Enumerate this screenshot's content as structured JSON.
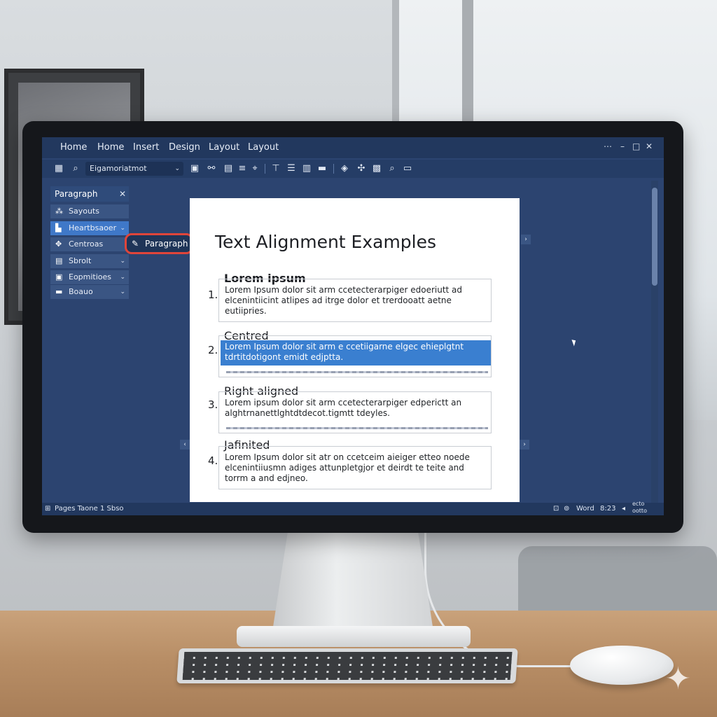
{
  "menubar": {
    "items": [
      "Home",
      "Home",
      "Insert",
      "Design",
      "Layout",
      "Layout"
    ]
  },
  "window_controls": {
    "menu": "⋯",
    "minimize": "–",
    "maximize": "□",
    "close": "✕"
  },
  "toolbar": {
    "style_select": "Eigamoriatmot",
    "icons": [
      "table-icon",
      "search-icon",
      "style-icon",
      "text-box-icon",
      "link-icon",
      "image-icon",
      "list-icon",
      "review-icon",
      "align-icon",
      "align-left-icon",
      "format-icon",
      "media-icon",
      "shapes-icon",
      "chart-icon",
      "picture-icon",
      "find-icon",
      "folder-icon"
    ]
  },
  "panel": {
    "title": "Paragraph",
    "close": "✕",
    "items": [
      {
        "label": "Sayouts",
        "icon": "layout-icon",
        "chevron": false,
        "active": false
      },
      {
        "label": "Heartbsaoer",
        "icon": "header-icon",
        "chevron": true,
        "active": true
      },
      {
        "label": "Centroas",
        "icon": "center-icon",
        "chevron": false,
        "active": false
      },
      {
        "label": "Sbrolt",
        "icon": "scroll-icon",
        "chevron": true,
        "active": false
      },
      {
        "label": "Eopmitioes",
        "icon": "format-icon",
        "chevron": true,
        "active": false
      },
      {
        "label": "Boauo",
        "icon": "box-icon",
        "chevron": true,
        "active": false
      }
    ]
  },
  "paragraph_button": {
    "label": "Paragraph",
    "icon": "pen-icon",
    "accent": "#e0453a"
  },
  "document": {
    "title": "Text Alignment Examples",
    "sections": [
      {
        "number": "1.",
        "heading": "Lorem ipsum",
        "text": "Lorem Ipsum dolor sit arm ccetecterarpiger edoeriutt ad elcenintiicint atlipes ad itrge dolor et trerdooatt aetne eutiipries."
      },
      {
        "number": "2.",
        "heading": "Centred",
        "text": "Lorem Ipsum dolor sit arm e ccetiigarne elgec ehieplgtnt tdrtitdotigont emidt edjptta."
      },
      {
        "number": "3.",
        "heading": "Right aligned",
        "text": "Lorem ipsum dolor sit arm ccetecterarpiger edperictt an alghtrnanettlghtdtdecot.tigmtt tdeyles."
      },
      {
        "number": "4.",
        "heading": "Jafinited",
        "text": "Lorem Ipsum dolor sit atr on ccetceim aieiger etteo noede elcenintiiusmn adiges attunpletgjor et deirdt te teite and torrm a and edjneo."
      }
    ]
  },
  "statusbar": {
    "left": "Pages Taone 1 Sbso",
    "app": "Word",
    "time": "8:23",
    "right": "ecto ootto"
  },
  "colors": {
    "screen_bg": "#2c4470",
    "menubar": "#22385e",
    "highlight": "#3a7fd0",
    "panel_active": "#3f78c8"
  }
}
